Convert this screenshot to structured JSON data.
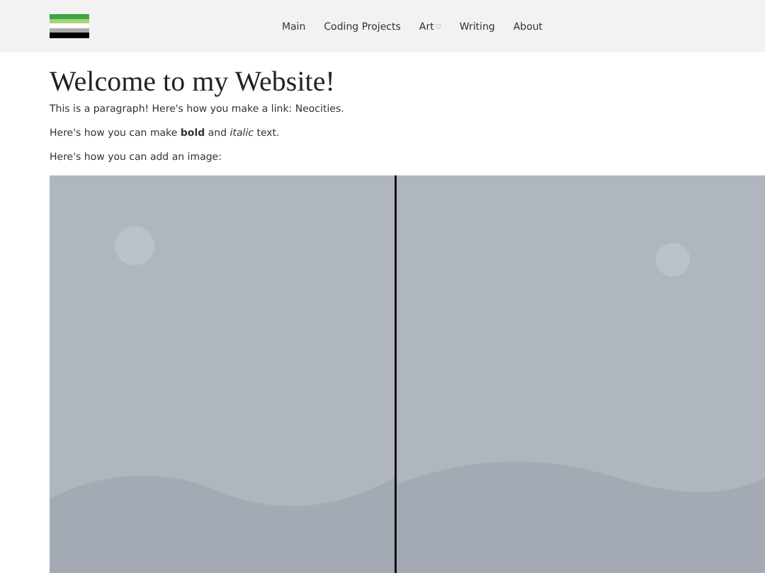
{
  "nav": {
    "items": [
      {
        "label": "Main",
        "kind": "link"
      },
      {
        "label": "Coding Projects",
        "kind": "link"
      },
      {
        "label": "Art",
        "kind": "dropdown"
      },
      {
        "label": "Writing",
        "kind": "link"
      },
      {
        "label": "About",
        "kind": "link"
      }
    ]
  },
  "content": {
    "heading": "Welcome to my Website!",
    "paragraphs": [
      {
        "text": "This is a paragraph! Here's how you make a link: ",
        "link": "Neocities",
        "after": "."
      },
      {
        "text": "Here's how you can make **bold** and *italic* text."
      },
      {
        "text": "Here's how you can add an image:"
      }
    ]
  }
}
